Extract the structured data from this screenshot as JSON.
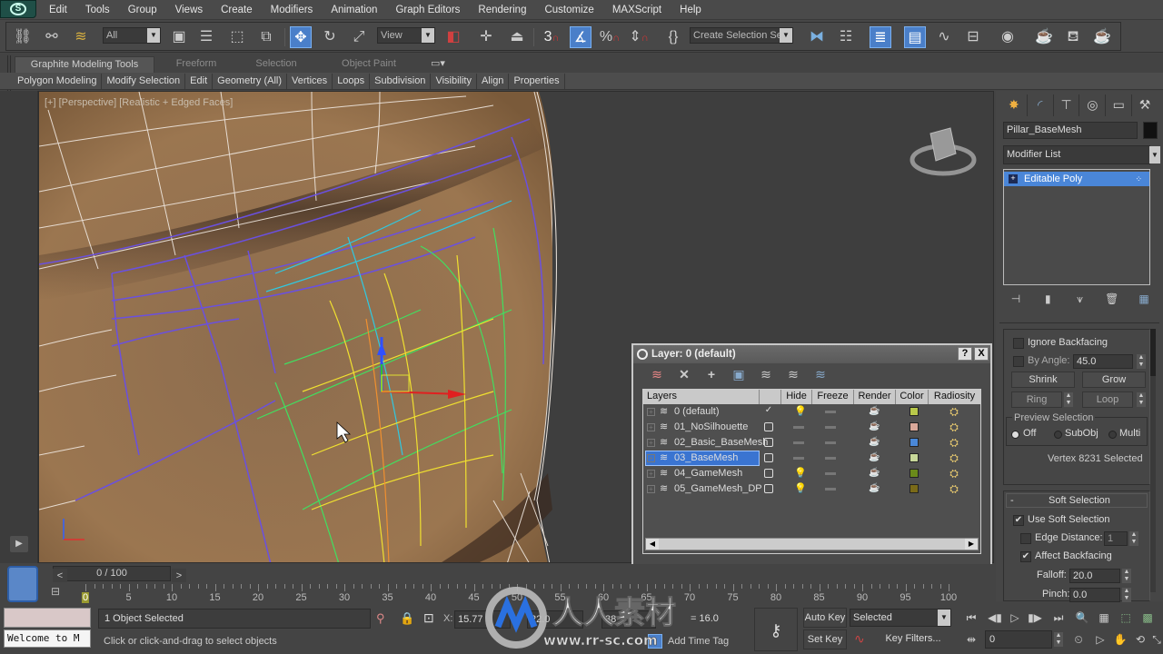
{
  "menubar": {
    "items": [
      "Edit",
      "Tools",
      "Group",
      "Views",
      "Create",
      "Modifiers",
      "Animation",
      "Graph Editors",
      "Rendering",
      "Customize",
      "MAXScript",
      "Help"
    ]
  },
  "toolbar": {
    "selection_filter": "All",
    "reference_coord": "View",
    "named_selection_set": "Create Selection Se",
    "snap_toggle_label": "3",
    "icons": [
      "link-icon",
      "unlink-icon",
      "bind-space-warp-icon",
      "select-object-icon",
      "select-by-name-icon",
      "rectangle-selection-icon",
      "window-crossing-icon",
      "select-and-move-icon",
      "select-and-rotate-icon",
      "select-and-scale-icon",
      "select-manipulate-icon",
      "pivot-center-icon",
      "keyboard-shortcut-override-icon",
      "snaps-toggle-icon",
      "angle-snap-icon",
      "percent-snap-icon",
      "spinner-snap-icon",
      "edit-named-selection-icon",
      "mirror-icon",
      "align-icon",
      "layer-manager-icon",
      "graphite-toggle-icon",
      "curve-editor-icon",
      "schematic-view-icon",
      "material-editor-icon",
      "render-setup-icon",
      "rendered-frame-window-icon",
      "render-production-icon"
    ]
  },
  "ribbon": {
    "tabs": [
      {
        "label": "Graphite Modeling Tools",
        "active": true
      },
      {
        "label": "Freeform",
        "active": false
      },
      {
        "label": "Selection",
        "active": false
      },
      {
        "label": "Object Paint",
        "active": false
      }
    ],
    "panels": [
      "Polygon Modeling",
      "Modify Selection",
      "Edit",
      "Geometry (All)",
      "Vertices",
      "Loops",
      "Subdivision",
      "Visibility",
      "Align",
      "Properties"
    ]
  },
  "viewport": {
    "label": "[+] [Perspective] [Realistic + Edged Faces]",
    "gizmo_axes": {
      "x": "x",
      "y": "y",
      "z": "z"
    },
    "mesh_color": "#8a6a4a"
  },
  "command_panel": {
    "tabs": [
      "create-icon",
      "modify-icon",
      "hierarchy-icon",
      "motion-icon",
      "display-icon",
      "utilities-icon"
    ],
    "object_name": "Pillar_BaseMesh",
    "object_color": "#111111",
    "modifier_list": "Modifier List",
    "stack": [
      {
        "label": "Editable Poly",
        "selected": true
      }
    ],
    "selection": {
      "ignore_backfacing": {
        "label": "Ignore Backfacing",
        "checked": false
      },
      "by_angle": {
        "label": "By Angle:",
        "checked": false,
        "value": "45.0"
      },
      "shrink": "Shrink",
      "grow": "Grow",
      "ring": "Ring",
      "loop": "Loop",
      "preview_selection": {
        "title": "Preview Selection",
        "options": [
          "Off",
          "SubObj",
          "Multi"
        ],
        "selected": "Off"
      },
      "status": "Vertex 8231 Selected"
    },
    "soft_selection": {
      "title": "Soft Selection",
      "collapse": "-",
      "use_soft_selection": {
        "label": "Use Soft Selection",
        "checked": true
      },
      "edge_distance": {
        "label": "Edge Distance:",
        "checked": false,
        "value": "1"
      },
      "affect_backfacing": {
        "label": "Affect Backfacing",
        "checked": true
      },
      "falloff": {
        "label": "Falloff:",
        "value": "20.0"
      },
      "pinch": {
        "label": "Pinch:",
        "value": "0.0"
      }
    }
  },
  "layer_dialog": {
    "title": "Layer: 0 (default)",
    "help": "?",
    "close": "X",
    "columns": [
      "Layers",
      "",
      "Hide",
      "Freeze",
      "Render",
      "Color",
      "Radiosity"
    ],
    "rows": [
      {
        "name": "0 (default)",
        "current": true,
        "hidden": true,
        "color": "#b8c84a",
        "selected": false
      },
      {
        "name": "01_NoSilhouette",
        "current": false,
        "hidden": false,
        "color": "#d9a89a",
        "selected": false
      },
      {
        "name": "02_Basic_BaseMesh",
        "current": false,
        "hidden": false,
        "color": "#4a88d8",
        "selected": false
      },
      {
        "name": "03_BaseMesh",
        "current": false,
        "hidden": false,
        "color": "#c8d89a",
        "selected": true
      },
      {
        "name": "04_GameMesh",
        "current": false,
        "hidden": true,
        "color": "#6a8a1a",
        "selected": false
      },
      {
        "name": "05_GameMesh_DP",
        "current": false,
        "hidden": true,
        "color": "#7a6a18",
        "selected": false
      }
    ]
  },
  "timeline": {
    "frame_display": "0 / 100",
    "prev": "<",
    "next": ">",
    "current_frame": 0,
    "start": 0,
    "end": 100,
    "ticks": [
      "0",
      "5",
      "10",
      "15",
      "20",
      "25",
      "30",
      "35",
      "40",
      "45",
      "50",
      "55",
      "60",
      "65",
      "70",
      "75",
      "80",
      "85",
      "90",
      "95",
      "100"
    ]
  },
  "status_bar": {
    "welcome": "Welcome to M",
    "selection_status": "1 Object Selected",
    "prompt": "Click or click-and-drag to select objects",
    "x_label": "X:",
    "x_value": "15.77",
    "y_value": "22.0",
    "z_value": "88",
    "grid": "= 16.0",
    "add_time_tag": "Add Time Tag",
    "auto_key": "Auto Key",
    "set_key": "Set Key",
    "key_mode": "Selected",
    "key_filters": "Key Filters...",
    "frame_input": "0"
  },
  "watermark": {
    "text": "人人素材",
    "url": "www.rr-sc.com"
  }
}
